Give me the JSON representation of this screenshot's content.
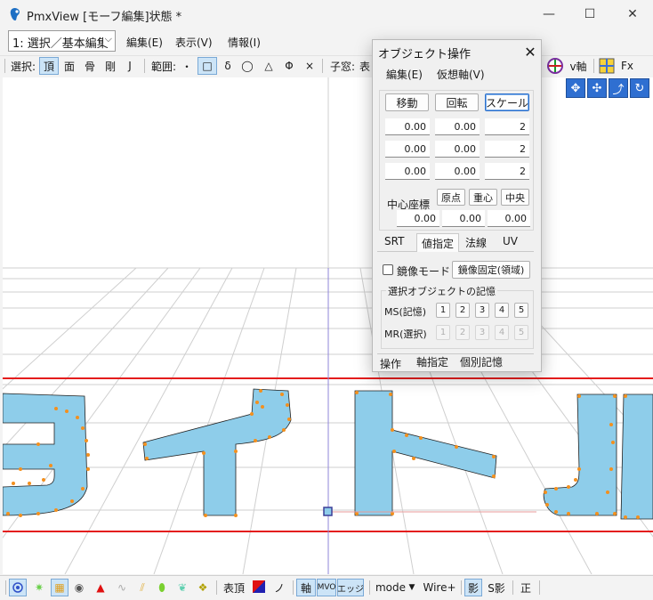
{
  "window": {
    "title": "PmxView  [モーフ編集]状態 *",
    "minimize": "—",
    "maximize": "☐",
    "close": "✕"
  },
  "menubar": {
    "mode_select": "1: 選択／基本編集",
    "items": [
      "編集(E)",
      "表示(V)",
      "情報(I)"
    ]
  },
  "toolbar": {
    "select_label": "選択:",
    "select_items": [
      "頂",
      "面",
      "骨",
      "剛",
      "J"
    ],
    "range_label": "範囲:",
    "range_items": [
      "・",
      "□",
      "δ",
      "◯",
      "△",
      "Φ",
      "×"
    ],
    "child_label": "子窓:",
    "child_item": "表",
    "right_items": [
      "v軸",
      "Fx"
    ]
  },
  "dialog": {
    "title": "オブジェクト操作",
    "close": "✕",
    "menu": [
      "編集(E)",
      "仮想軸(V)"
    ],
    "buttons": {
      "move": "移動",
      "rotate": "回転",
      "scale": "スケール"
    },
    "rows": [
      [
        "0.00",
        "0.00",
        "2"
      ],
      [
        "0.00",
        "0.00",
        "2"
      ],
      [
        "0.00",
        "0.00",
        "2"
      ]
    ],
    "center_label": "中心座標",
    "center_buttons": [
      "原点",
      "重心",
      "中央"
    ],
    "center_values": [
      "0.00",
      "0.00",
      "0.00"
    ],
    "tabs": [
      "SRT",
      "値指定",
      "法線",
      "UV"
    ],
    "mirror_mode": "鏡像モード",
    "mirror_fix": "鏡像固定(領域)",
    "memory_title": "選択オブジェクトの記憶",
    "ms_label": "MS(記憶)",
    "mr_label": "MR(選択)",
    "slots": [
      "1",
      "2",
      "3",
      "4",
      "5"
    ],
    "bottom_tabs": [
      "操作",
      "軸指定",
      "個別記憶"
    ]
  },
  "bottombar": {
    "face_label": "表頂",
    "no_label": "ノ",
    "axis_label": "軸",
    "mvo_label": "MVO",
    "edge_label": "エッジ",
    "mode_label": "mode",
    "wire_label": "Wire+",
    "shadow_label": "影",
    "sshadow_label": "S影",
    "correct_label": "正"
  },
  "colors": {
    "shape_fill": "#8ecdea",
    "vertex": "#f3901e",
    "red_line": "#e41d1d",
    "grid": "#cfcfcf",
    "accent": "#2f6fd1"
  }
}
